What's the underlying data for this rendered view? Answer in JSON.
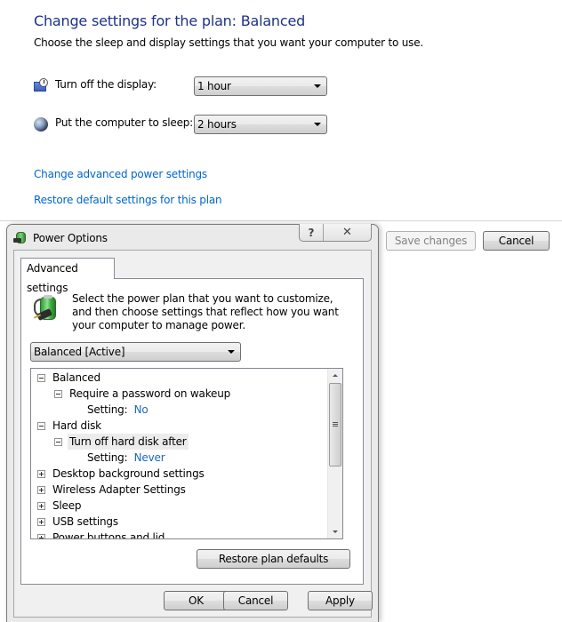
{
  "page": {
    "title": "Change settings for the plan: Balanced",
    "subtitle": "Choose the sleep and display settings that you want your computer to use.",
    "settings": [
      {
        "icon": "display-clock-icon",
        "label": "Turn off the display:",
        "value": "1 hour"
      },
      {
        "icon": "sleep-moon-icon",
        "label": "Put the computer to sleep:",
        "value": "2 hours"
      }
    ],
    "links": {
      "advanced": "Change advanced power settings",
      "restore": "Restore default settings for this plan"
    },
    "buttons": {
      "save": "Save changes",
      "cancel": "Cancel"
    }
  },
  "dialog": {
    "title": "Power Options",
    "help_glyph": "?",
    "close_glyph": "✕",
    "tab": "Advanced settings",
    "intro": "Select the power plan that you want to customize, and then choose settings that reflect how you want your computer to manage power.",
    "plan_selected": "Balanced [Active]",
    "tree": [
      {
        "level": 0,
        "expander": "minus",
        "text": "Balanced"
      },
      {
        "level": 1,
        "expander": "minus",
        "text": "Require a password on wakeup"
      },
      {
        "level": 2,
        "label": "Setting:",
        "value": "No"
      },
      {
        "level": 0,
        "expander": "minus",
        "text": "Hard disk"
      },
      {
        "level": 1,
        "expander": "minus",
        "text": "Turn off hard disk after",
        "selected": true
      },
      {
        "level": 2,
        "label": "Setting:",
        "value": "Never"
      },
      {
        "level": 0,
        "expander": "plus",
        "text": "Desktop background settings"
      },
      {
        "level": 0,
        "expander": "plus",
        "text": "Wireless Adapter Settings"
      },
      {
        "level": 0,
        "expander": "plus",
        "text": "Sleep"
      },
      {
        "level": 0,
        "expander": "plus",
        "text": "USB settings"
      },
      {
        "level": 0,
        "expander": "plus",
        "text": "Power buttons and lid"
      }
    ],
    "buttons": {
      "restore": "Restore plan defaults",
      "ok": "OK",
      "cancel": "Cancel",
      "apply": "Apply"
    }
  },
  "colors": {
    "title": "#1e3287",
    "link": "#0066cc",
    "setting_value": "#1a66c7"
  }
}
